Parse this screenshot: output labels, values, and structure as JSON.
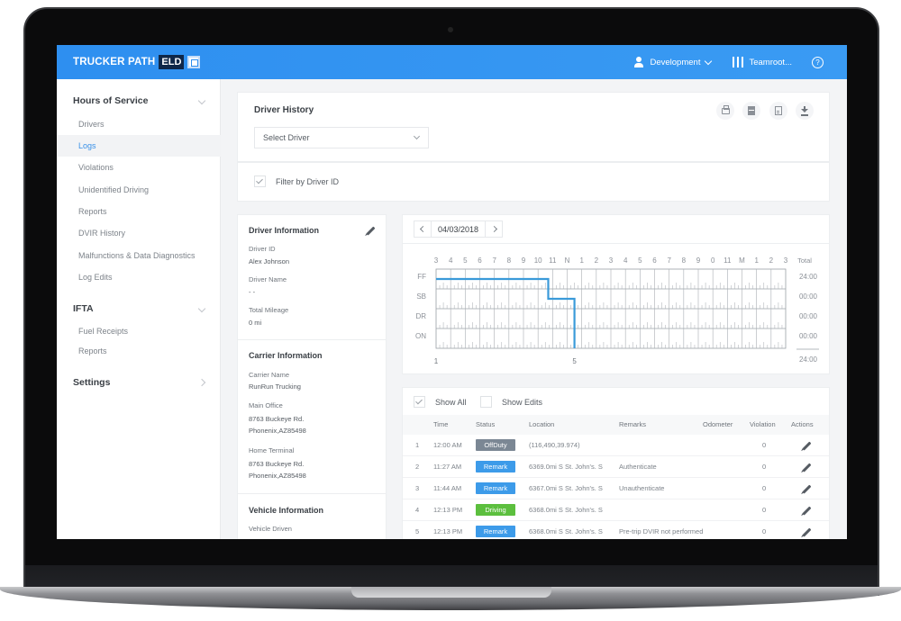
{
  "app": {
    "brand": "TRUCKER PATH",
    "brand_badge": "ELD"
  },
  "topbar": {
    "account_label": "Development",
    "team_label": "Teamroot...",
    "help_label": "?"
  },
  "sidebar": {
    "sections": [
      {
        "label": "Hours of Service",
        "expanded": true,
        "items": [
          {
            "label": "Drivers",
            "active": false
          },
          {
            "label": "Logs",
            "active": true
          },
          {
            "label": "Violations",
            "active": false
          },
          {
            "label": "Unidentified Driving",
            "active": false
          },
          {
            "label": "Reports",
            "active": false
          },
          {
            "label": "DVIR History",
            "active": false
          },
          {
            "label": "Malfunctions & Data Diagnostics",
            "active": false
          },
          {
            "label": "Log Edits",
            "active": false
          }
        ]
      },
      {
        "label": "IFTA",
        "expanded": true,
        "items": [
          {
            "label": "Fuel Receipts",
            "active": false
          },
          {
            "label": "Reports",
            "active": false
          }
        ]
      },
      {
        "label": "Settings",
        "expanded": false,
        "items": []
      }
    ]
  },
  "history": {
    "title": "Driver History",
    "select_placeholder": "Select Driver",
    "tools": [
      "print-icon",
      "document-icon",
      "file-icon",
      "download-icon"
    ],
    "filter_label": "Filter by Driver ID",
    "filter_checked": true
  },
  "driver_info": {
    "title": "Driver Information",
    "fields": [
      {
        "label": "Driver ID",
        "value": "Alex Johnson"
      },
      {
        "label": "Driver Name",
        "value": "- -"
      },
      {
        "label": "Total Mileage",
        "value": "0 mi"
      }
    ],
    "carrier_title": "Carrier Information",
    "carrier_fields": [
      {
        "label": "Carrier Name",
        "value": "RunRun Trucking"
      },
      {
        "label": "Main Office",
        "value": "8763 Buckeye Rd.",
        "value2": "Phonenix,AZ85498"
      },
      {
        "label": "Home Terminal",
        "value": "8763 Buckeye Rd.",
        "value2": "Phonenix,AZ85498"
      }
    ],
    "vehicle_title": "Vehicle Information",
    "vehicle_fields": [
      {
        "label": "Vehicle Driven",
        "value": ""
      }
    ]
  },
  "log": {
    "date": "04/03/2018",
    "hour_labels": [
      "3",
      "4",
      "5",
      "6",
      "7",
      "8",
      "9",
      "10",
      "11",
      "N",
      "1",
      "2",
      "3",
      "4",
      "5",
      "6",
      "7",
      "8",
      "9",
      "0",
      "11",
      "M",
      "1",
      "2",
      "3"
    ],
    "total_label": "Total",
    "rows": [
      {
        "label": "FF",
        "total": "24:00"
      },
      {
        "label": "SB",
        "total": "00:00"
      },
      {
        "label": "DR",
        "total": "00:00"
      },
      {
        "label": "ON",
        "total": "00:00"
      }
    ],
    "grand_total": "24:00",
    "event_markers": [
      {
        "label": "1",
        "hour": 0
      },
      {
        "label": "5",
        "hour": 9.5
      }
    ],
    "line_color": "#3a9ad9",
    "segments": [
      {
        "status_row": 0,
        "start": 0,
        "end": 7.7
      },
      {
        "status_row": 1,
        "start": 7.7,
        "end": 9.5
      },
      {
        "status_row": 3,
        "start": 9.5,
        "end": 9.5
      }
    ]
  },
  "events": {
    "show_all_label": "Show All",
    "show_all_checked": true,
    "show_edits_label": "Show Edits",
    "show_edits_checked": false,
    "columns": [
      "Time",
      "Status",
      "Location",
      "Remarks",
      "Odometer",
      "Violation",
      "Actions"
    ],
    "rows": [
      {
        "n": "1",
        "time": "12:00 AM",
        "status": "OffDuty",
        "color": "#7b8794",
        "location": "(116,490,39.974)",
        "remarks": "",
        "odometer": "",
        "violation": "0"
      },
      {
        "n": "2",
        "time": "11:27 AM",
        "status": "Remark",
        "color": "#3d9be9",
        "location": "6369.0mi S St. John's. S",
        "remarks": "Authenticate",
        "odometer": "",
        "violation": "0"
      },
      {
        "n": "3",
        "time": "11:44 AM",
        "status": "Remark",
        "color": "#3d9be9",
        "location": "6367.0mi S St. John's. S",
        "remarks": "Unauthenticate",
        "odometer": "",
        "violation": "0"
      },
      {
        "n": "4",
        "time": "12:13 PM",
        "status": "Driving",
        "color": "#5cbf3e",
        "location": "6368.0mi S St. John's. S",
        "remarks": "",
        "odometer": "",
        "violation": "0"
      },
      {
        "n": "5",
        "time": "12:13 PM",
        "status": "Remark",
        "color": "#3d9be9",
        "location": "6368.0mi S St. John's. S",
        "remarks": "Pre-trip DVIR not performed",
        "odometer": "",
        "violation": "0"
      }
    ]
  }
}
